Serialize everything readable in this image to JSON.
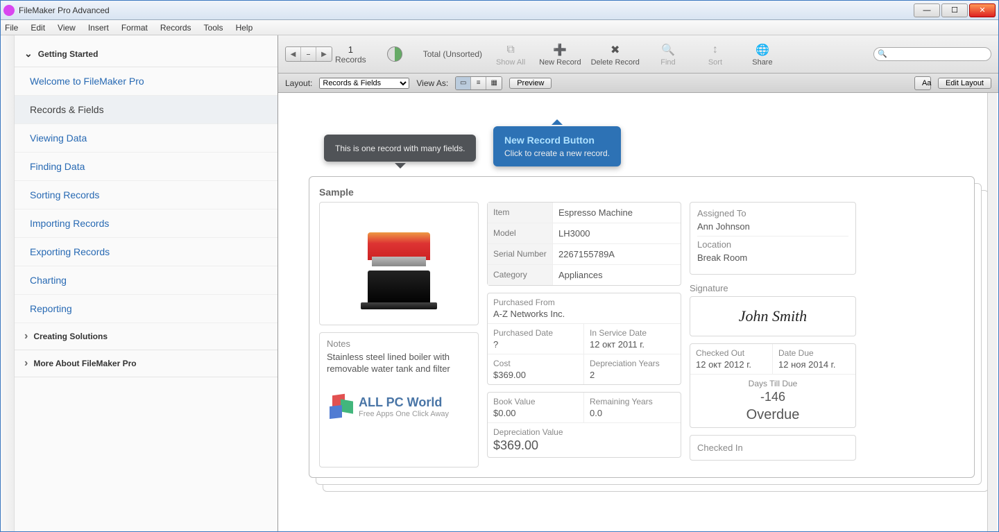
{
  "window": {
    "title": "FileMaker Pro Advanced"
  },
  "menus": [
    "File",
    "Edit",
    "View",
    "Insert",
    "Format",
    "Records",
    "Tools",
    "Help"
  ],
  "sidebar": {
    "sections": [
      {
        "title": "Getting Started",
        "expanded": true,
        "items": [
          "Welcome to FileMaker Pro",
          "Records & Fields",
          "Viewing Data",
          "Finding Data",
          "Sorting Records",
          "Importing Records",
          "Exporting Records",
          "Charting",
          "Reporting"
        ],
        "activeIndex": 1
      },
      {
        "title": "Creating Solutions",
        "expanded": false
      },
      {
        "title": "More About FileMaker Pro",
        "expanded": false
      }
    ]
  },
  "toolbar": {
    "recordsLabel": "Records",
    "recordCount": "1",
    "totalLabel": "Total (Unsorted)",
    "showAll": "Show All",
    "newRecord": "New Record",
    "deleteRecord": "Delete Record",
    "find": "Find",
    "sort": "Sort",
    "share": "Share"
  },
  "layoutbar": {
    "layoutLabel": "Layout:",
    "layoutValue": "Records & Fields",
    "viewAsLabel": "View As:",
    "preview": "Preview",
    "aa": "Aa",
    "editLayout": "Edit Layout"
  },
  "callouts": {
    "gray": "This is one record with many fields.",
    "blueTitle": "New Record Button",
    "blueBody": "Click to create a new record."
  },
  "card": {
    "title": "Sample",
    "item": {
      "label": "Item",
      "value": "Espresso Machine"
    },
    "model": {
      "label": "Model",
      "value": "LH3000"
    },
    "serial": {
      "label": "Serial Number",
      "value": "2267155789A"
    },
    "category": {
      "label": "Category",
      "value": "Appliances"
    },
    "purchasedFrom": {
      "label": "Purchased From",
      "value": "A-Z Networks Inc."
    },
    "purchasedDate": {
      "label": "Purchased Date",
      "value": "?"
    },
    "inServiceDate": {
      "label": "In Service Date",
      "value": "12 окт 2011 г."
    },
    "cost": {
      "label": "Cost",
      "value": "$369.00"
    },
    "depreciationYears": {
      "label": "Depreciation Years",
      "value": "2"
    },
    "bookValue": {
      "label": "Book Value",
      "value": "$0.00"
    },
    "remainingYears": {
      "label": "Remaining Years",
      "value": "0.0"
    },
    "depreciationValue": {
      "label": "Depreciation Value",
      "value": "$369.00"
    },
    "notes": {
      "label": "Notes",
      "value": "Stainless steel lined boiler with removable water tank and filter"
    },
    "assignedTo": {
      "label": "Assigned To",
      "value": "Ann Johnson"
    },
    "location": {
      "label": "Location",
      "value": "Break Room"
    },
    "signatureLabel": "Signature",
    "signature": "John Smith",
    "checkedOut": {
      "label": "Checked Out",
      "value": "12 окт 2012 г."
    },
    "dateDue": {
      "label": "Date Due",
      "value": "12 ноя 2014 г."
    },
    "daysTillDue": {
      "label": "Days Till Due",
      "value": "-146"
    },
    "overdue": "Overdue",
    "checkedIn": {
      "label": "Checked In",
      "value": ""
    }
  },
  "watermark": {
    "title": "ALL PC World",
    "subtitle": "Free Apps One Click Away"
  }
}
